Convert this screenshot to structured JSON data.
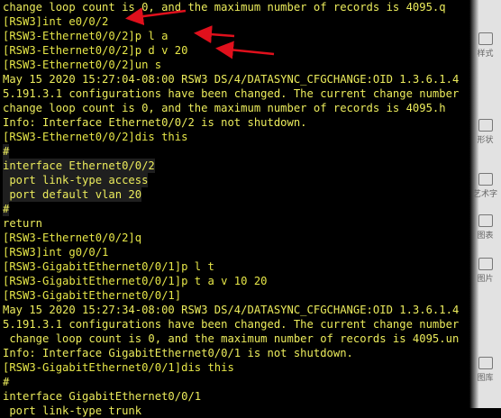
{
  "terminal": {
    "lines": [
      {
        "text": "change loop count is 0, and the maximum number of records is 4095.q",
        "kind": "output"
      },
      {
        "text": "[RSW3]int e0/0/2",
        "kind": "prompt"
      },
      {
        "text": "[RSW3-Ethernet0/0/2]p l a",
        "kind": "prompt"
      },
      {
        "text": "[RSW3-Ethernet0/0/2]p d v 20",
        "kind": "prompt"
      },
      {
        "text": "[RSW3-Ethernet0/0/2]un s",
        "kind": "prompt"
      },
      {
        "text": "May 15 2020 15:27:04-08:00 RSW3 DS/4/DATASYNC_CFGCHANGE:OID 1.3.6.1.4",
        "kind": "output"
      },
      {
        "text": "5.191.3.1 configurations have been changed. The current change number",
        "kind": "output"
      },
      {
        "text": "change loop count is 0, and the maximum number of records is 4095.h",
        "kind": "output"
      },
      {
        "text": "Info: Interface Ethernet0/0/2 is not shutdown.",
        "kind": "output"
      },
      {
        "text": "[RSW3-Ethernet0/0/2]dis this",
        "kind": "prompt"
      },
      {
        "text": "#",
        "kind": "output"
      },
      {
        "text": "interface Ethernet0/0/2",
        "kind": "output"
      },
      {
        "text": " port link-type access",
        "kind": "output"
      },
      {
        "text": " port default vlan 20",
        "kind": "output"
      },
      {
        "text": "#",
        "kind": "output"
      },
      {
        "text": "return",
        "kind": "output"
      },
      {
        "text": "[RSW3-Ethernet0/0/2]q",
        "kind": "prompt"
      },
      {
        "text": "[RSW3]int g0/0/1",
        "kind": "prompt"
      },
      {
        "text": "[RSW3-GigabitEthernet0/0/1]p l t",
        "kind": "prompt"
      },
      {
        "text": "[RSW3-GigabitEthernet0/0/1]p t a v 10 20",
        "kind": "prompt"
      },
      {
        "text": "[RSW3-GigabitEthernet0/0/1]",
        "kind": "prompt"
      },
      {
        "text": "May 15 2020 15:27:34-08:00 RSW3 DS/4/DATASYNC_CFGCHANGE:OID 1.3.6.1.4",
        "kind": "output"
      },
      {
        "text": "5.191.3.1 configurations have been changed. The current change number",
        "kind": "output"
      },
      {
        "text": " change loop count is 0, and the maximum number of records is 4095.un",
        "kind": "output"
      },
      {
        "text": "Info: Interface GigabitEthernet0/0/1 is not shutdown.",
        "kind": "output"
      },
      {
        "text": "[RSW3-GigabitEthernet0/0/1]dis this",
        "kind": "prompt"
      },
      {
        "text": "#",
        "kind": "output"
      },
      {
        "text": "interface GigabitEthernet0/0/1",
        "kind": "output"
      },
      {
        "text": " port link-type trunk",
        "kind": "output"
      }
    ]
  },
  "right_panel": {
    "items": [
      {
        "label": "样式",
        "icon": "style-icon"
      },
      {
        "label": "形状",
        "icon": "shape-icon"
      },
      {
        "label": "艺术字",
        "icon": "wordart-icon"
      },
      {
        "label": "图表",
        "icon": "chart-icon"
      },
      {
        "label": "图片",
        "icon": "picture-icon"
      },
      {
        "label": "图库",
        "icon": "gallery-icon"
      }
    ]
  },
  "colors": {
    "terminal_bg": "#000000",
    "text_yellow": "#e6e648",
    "arrow_red": "#e0101c"
  }
}
